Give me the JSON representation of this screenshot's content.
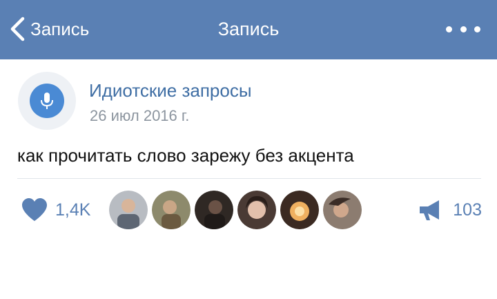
{
  "header": {
    "back_label": "Запись",
    "title": "Запись",
    "bar_color": "#5a80b4"
  },
  "post": {
    "author": "Идиотские запросы",
    "date": "26 июл 2016 г.",
    "text": "как прочитать слово зарежу без акцента",
    "avatar_icon": "microphone-icon"
  },
  "footer": {
    "like_count": "1,4K",
    "like_icon": "heart-icon",
    "share_count": "103",
    "share_icon": "megaphone-icon",
    "likers": [
      {
        "name": "liker-avatar-1",
        "color": "#8a8f96"
      },
      {
        "name": "liker-avatar-2",
        "color": "#9a8a6a"
      },
      {
        "name": "liker-avatar-3",
        "color": "#3c3430"
      },
      {
        "name": "liker-avatar-4",
        "color": "#7a5a4c"
      },
      {
        "name": "liker-avatar-5",
        "color": "#c9863a"
      },
      {
        "name": "liker-avatar-6",
        "color": "#6e5c52"
      }
    ]
  }
}
